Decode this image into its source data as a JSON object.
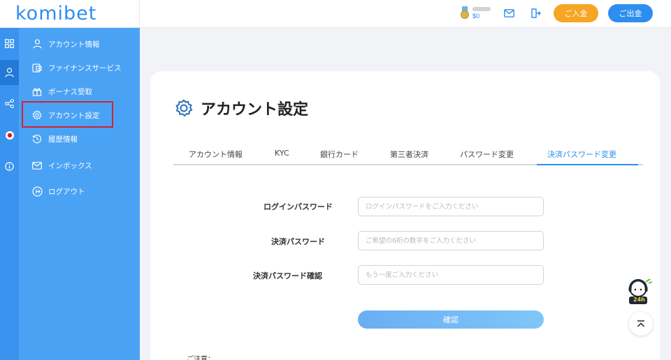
{
  "brand": {
    "logo_text": "komibet"
  },
  "header": {
    "balance": "$0",
    "deposit_label": "ご入金",
    "withdraw_label": "ご出金",
    "icons": [
      "medal-icon",
      "mail-icon",
      "logout-icon"
    ]
  },
  "rail": {
    "icons": [
      "grid-icon",
      "user-icon",
      "share-icon",
      "live-icon",
      "info-icon"
    ]
  },
  "sidebar": {
    "items": [
      {
        "label": "アカウント情報",
        "icon": "user-icon"
      },
      {
        "label": "ファイナンスサービス",
        "icon": "wallet-icon"
      },
      {
        "label": "ボーナス受取",
        "icon": "gift-icon"
      },
      {
        "label": "アカウント設定",
        "icon": "gear-icon"
      },
      {
        "label": "履歴情報",
        "icon": "history-icon"
      },
      {
        "label": "インボックス",
        "icon": "mail-icon"
      },
      {
        "label": "ログアウト",
        "icon": "logout-icon"
      }
    ]
  },
  "main": {
    "title": "アカウント設定",
    "tabs": [
      {
        "label": "アカウント情報"
      },
      {
        "label": "KYC"
      },
      {
        "label": "銀行カード"
      },
      {
        "label": "第三者決済"
      },
      {
        "label": "パスワード変更"
      },
      {
        "label": "決済パスワード変更",
        "active": true
      }
    ],
    "form": {
      "login_password_label": "ログインパスワード",
      "login_password_placeholder": "ログインパスワードをご入力ください",
      "payment_password_label": "決済パスワード",
      "payment_password_placeholder": "ご希望の6桁の数字をご入力ください",
      "payment_password_confirm_label": "決済パスワード確認",
      "payment_password_confirm_placeholder": "もう一度ご入力ください",
      "confirm_label": "確認"
    },
    "notice_label": "ご注意："
  },
  "floating": {
    "support_badge": "24h"
  },
  "colors": {
    "primary": "#2e8ef0",
    "sidebar": "#4aa2f5",
    "rail": "#3a93ee",
    "deposit": "#f5a623",
    "highlight": "#d2232a"
  }
}
